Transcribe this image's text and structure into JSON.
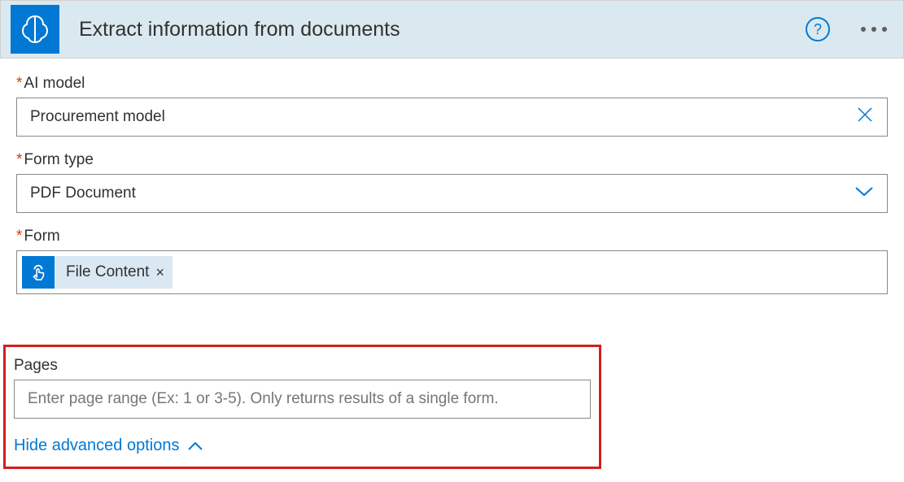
{
  "header": {
    "title": "Extract information from documents"
  },
  "fields": {
    "aiModel": {
      "label": "AI model",
      "value": "Procurement model"
    },
    "formType": {
      "label": "Form type",
      "value": "PDF Document"
    },
    "form": {
      "label": "Form",
      "chipLabel": "File Content"
    },
    "pages": {
      "label": "Pages",
      "placeholder": "Enter page range (Ex: 1 or 3-5). Only returns results of a single form."
    }
  },
  "toggle": {
    "hideAdvancedLabel": "Hide advanced options"
  }
}
